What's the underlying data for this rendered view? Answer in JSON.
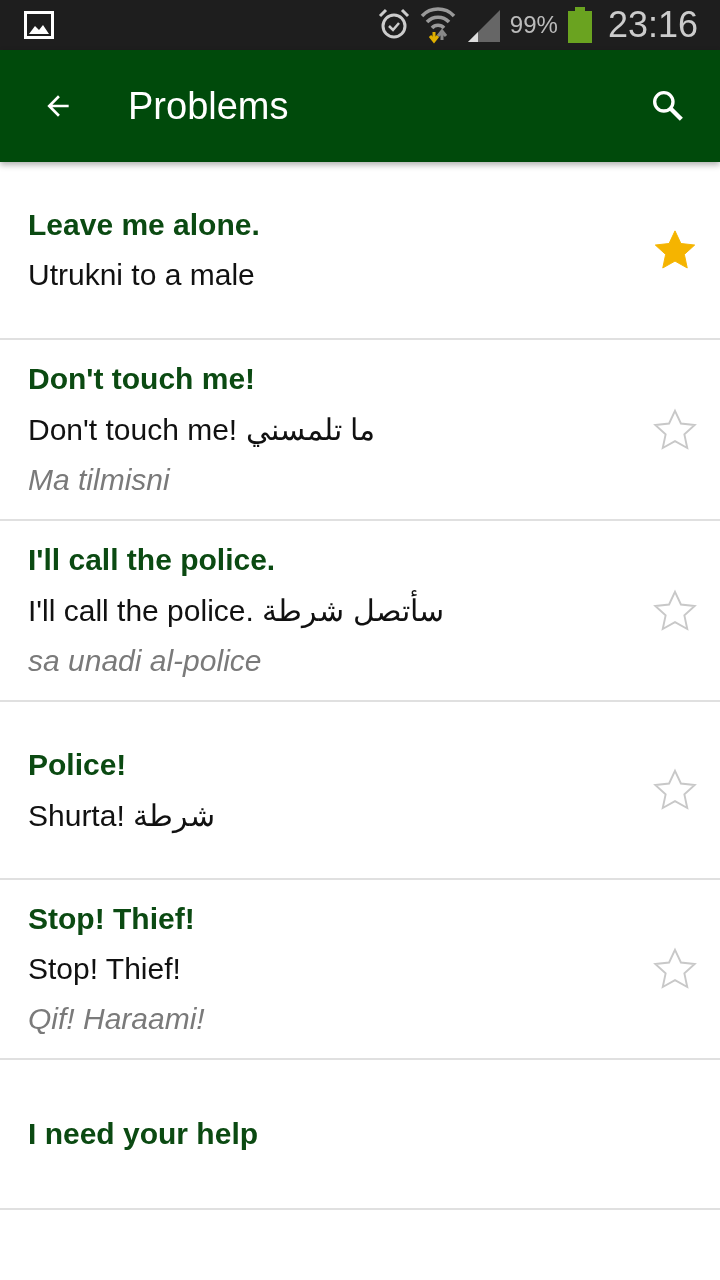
{
  "status_bar": {
    "battery": "99%",
    "time": "23:16"
  },
  "app_bar": {
    "title": "Problems"
  },
  "phrases": [
    {
      "title": "Leave me alone.",
      "translation": "Utrukni to a male",
      "starred": true
    },
    {
      "title": "Don't touch me!",
      "translation": "Don't touch me! ما تلمسني",
      "pronunciation": "Ma tilmisni",
      "starred": false
    },
    {
      "title": "I'll call the police.",
      "translation": "I'll call the police. سأتصل شرطة",
      "pronunciation": "sa unadi al-police",
      "starred": false
    },
    {
      "title": "Police!",
      "translation": "Shurta! شرطة",
      "starred": false
    },
    {
      "title": "Stop! Thief!",
      "translation": "Stop! Thief!",
      "pronunciation": "Qif! Haraami!",
      "starred": false
    },
    {
      "title": "I need your help"
    }
  ]
}
